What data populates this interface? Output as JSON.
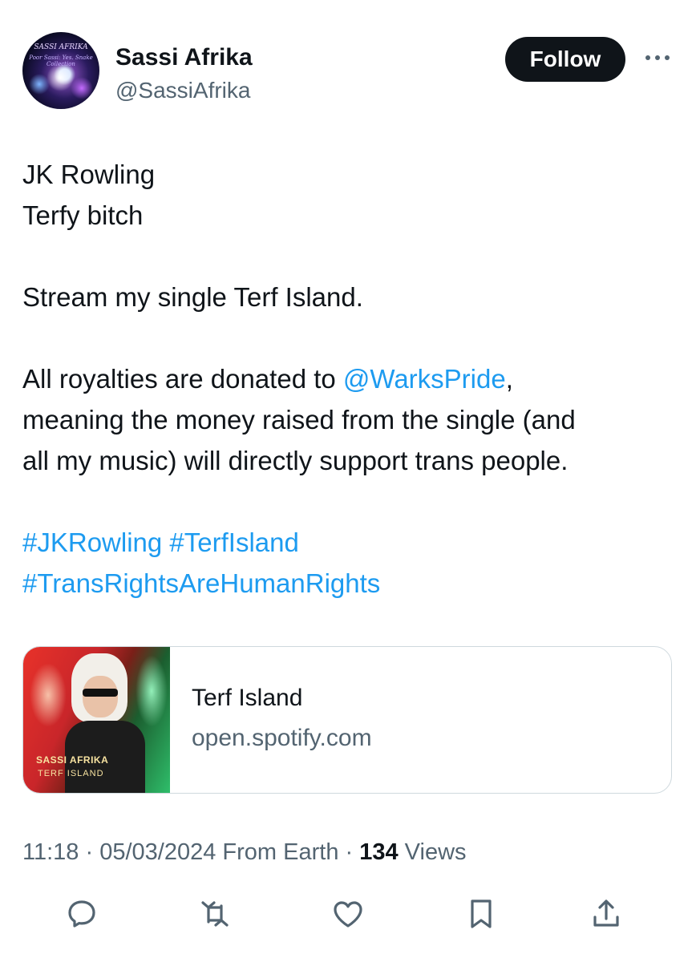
{
  "author": {
    "name": "Sassi Afrika",
    "handle": "@SassiAfrika",
    "avatar_text": "SASSI AFRIKA",
    "avatar_subtext": "Poor Sassi: Yes. Snake Collection"
  },
  "follow_label": "Follow",
  "tweet": {
    "line1": "JK Rowling",
    "line2": "Terfy bitch",
    "line3": "Stream my single Terf Island.",
    "line4_prefix": "All royalties are donated to ",
    "mention": "@WarksPride",
    "line4_suffix": ",",
    "line5": "meaning the money raised from the single (and",
    "line6": "all my music) will directly support trans people.",
    "hashtag1": "#JKRowling",
    "hashtag2": "#TerfIsland",
    "hashtag3": "#TransRightsAreHumanRights"
  },
  "card": {
    "title": "Terf Island",
    "domain": "open.spotify.com",
    "art_title": "SASSI AFRIKA",
    "art_subtitle": "TERF ISLAND"
  },
  "meta": {
    "time": "11:18",
    "sep1": " · ",
    "date": "05/03/2024",
    "source": " From Earth",
    "sep2": " · ",
    "views_count": "134",
    "views_label": " Views"
  },
  "colors": {
    "text": "#0f1419",
    "secondary": "#536471",
    "link": "#1d9bf0",
    "follow_bg": "#0f1419",
    "border": "#cfd9de"
  },
  "icons": [
    "more-icon",
    "reply-icon",
    "retweet-icon",
    "like-icon",
    "bookmark-icon",
    "share-icon"
  ]
}
